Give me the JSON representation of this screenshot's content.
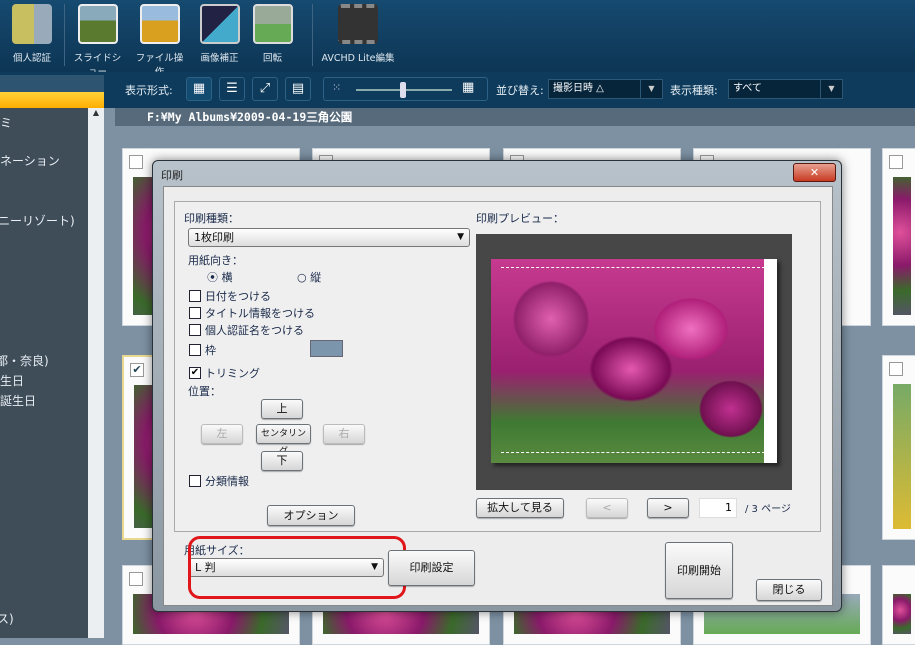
{
  "toolbar": {
    "items": [
      {
        "label": "個人認証",
        "icon": "face-recognition-icon"
      },
      {
        "label": "スライドショー",
        "icon": "slideshow-icon"
      },
      {
        "label": "ファイル操作",
        "icon": "file-operation-icon"
      },
      {
        "label": "画像補正",
        "icon": "image-correction-icon"
      },
      {
        "label": "回転",
        "icon": "rotate-icon"
      },
      {
        "label": "AVCHD Lite編集",
        "icon": "video-edit-icon"
      }
    ]
  },
  "viewbar": {
    "display_format_label": "表示形式:",
    "sort_label": "並び替え:",
    "sort_value": "撮影日時 △",
    "type_label": "表示種類:",
    "type_value": "すべて"
  },
  "path": "F:¥My Albums¥2009-04-19三角公園",
  "sidebar": {
    "items": [
      "ネーション",
      "ニーリゾート)",
      "都・奈良)",
      "生日",
      "誕生日",
      "ス)"
    ],
    "partial_first": "ミ"
  },
  "dialog": {
    "title": "印刷",
    "close": "✕",
    "print_type_label": "印刷種類：",
    "print_type_value": "1枚印刷",
    "orientation_label": "用紙向き：",
    "orient_landscape": "横",
    "orient_portrait": "縦",
    "add_date": "日付をつける",
    "add_title": "タイトル情報をつける",
    "add_person": "個人認証名をつける",
    "frame": "枠",
    "trimming": "トリミング",
    "position_label": "位置：",
    "up": "上",
    "left": "左",
    "center": "センタリング",
    "right": "右",
    "down": "下",
    "category": "分類情報",
    "options": "オプション",
    "preview_label": "印刷プレビュー：",
    "zoom_view": "拡大して見る",
    "prev": "<",
    "next": ">",
    "page_value": "1",
    "page_total": "/ 3 ページ",
    "paper_size_label": "用紙サイズ：",
    "paper_size_value": "L 判",
    "print_settings": "印刷設定",
    "print_start": "印刷開始",
    "close_button": "閉じる"
  },
  "colors": {
    "accent_red": "#e0161a",
    "frame_color": "#7b95ad"
  }
}
